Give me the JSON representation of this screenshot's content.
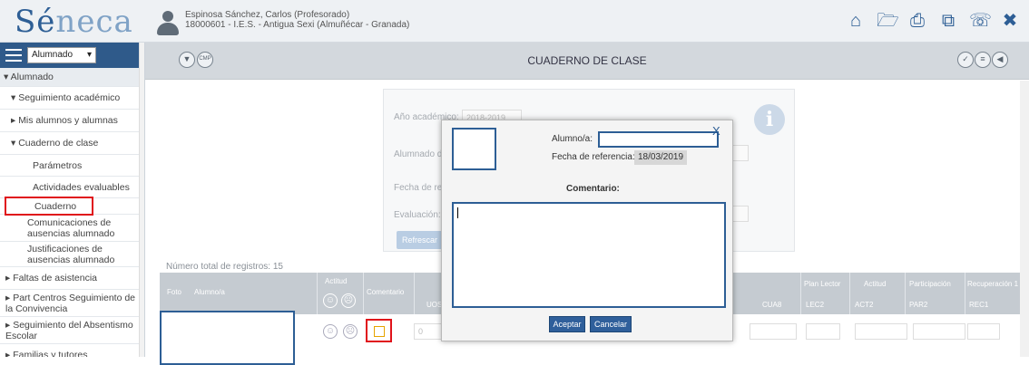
{
  "header": {
    "logo": {
      "se": "Sé",
      "neca": "neca"
    },
    "user_name": "Espinosa Sánchez, Carlos (Profesorado)",
    "user_center": "18000601 - I.E.S. - Antigua Sexi (Almuñécar - Granada)",
    "icons": [
      "home-icon",
      "folder-icon",
      "print-icon",
      "copy-icon",
      "phone-icon",
      "close-icon"
    ],
    "icon_glyphs": {
      "home": "⌂",
      "folder": "🗁",
      "print": "⎙",
      "copy": "⧉",
      "phone": "☏",
      "close": "✖"
    }
  },
  "sidebar": {
    "profile_select": "Alumnado",
    "items": [
      {
        "label": "▾ Alumnado"
      },
      {
        "label": "▾ Seguimiento académico"
      },
      {
        "label": "▸ Mis alumnos y alumnas"
      },
      {
        "label": "▾ Cuaderno de clase"
      },
      {
        "label": "Parámetros"
      },
      {
        "label": "Actividades evaluables"
      },
      {
        "label": "Cuaderno"
      },
      {
        "label": "Comunicaciones de ausencias alumnado"
      },
      {
        "label": "Justificaciones de ausencias alumnado"
      },
      {
        "label": "▸ Faltas de asistencia"
      },
      {
        "label": "▸ Part Centros Seguimiento de la Convivencia"
      },
      {
        "label": "▸ Seguimiento del Absentismo Escolar"
      },
      {
        "label": "▸ Familias y tutores"
      }
    ]
  },
  "page": {
    "title": "CUADERNO DE CLASE",
    "header_left_icons": [
      "filter-icon",
      "cmp-icon"
    ],
    "header_left_glyphs": [
      "▼",
      "CMP"
    ],
    "header_right_icons": [
      "check-icon",
      "list-icon",
      "back-icon"
    ],
    "header_right_glyphs": [
      "✓",
      "≡",
      "◀"
    ]
  },
  "form": {
    "year_label": "Año académico:",
    "year_value": "2018-2019",
    "alumnado_label": "Alumnado d",
    "fecha_label": "Fecha de re",
    "evaluacion_label": "Evaluación:",
    "refresh_label": "Refrescar",
    "info_glyph": "i"
  },
  "grid": {
    "total_records": "Número total de registros: 15",
    "headers": {
      "foto": "Foto",
      "alumno": "Alumno/a",
      "actitud": "Actitud",
      "comentario": "Comentario",
      "uos": "UOS",
      "cua8": "CUA8",
      "plan_lector": "Plan Lector",
      "lec2": "LEC2",
      "actitud2": "Actitud",
      "act2": "ACT2",
      "participacion": "Participación",
      "par2": "PAR2",
      "recuperacion": "Recuperación 1",
      "rec1": "REC1"
    },
    "faces": {
      "happy": "☺",
      "sad": "☹"
    },
    "row_value": "0"
  },
  "modal": {
    "alumno_label": "Alumno/a:",
    "alumno_value": "",
    "fecha_label": "Fecha de referencia:",
    "fecha_value": "18/03/2019",
    "comentario_label": "Comentario:",
    "comment_text": "",
    "close_glyph": "X",
    "accept_label": "Aceptar",
    "cancel_label": "Cancelar"
  },
  "colors": {
    "brand": "#2d5e95",
    "highlight": "#e0121a"
  }
}
